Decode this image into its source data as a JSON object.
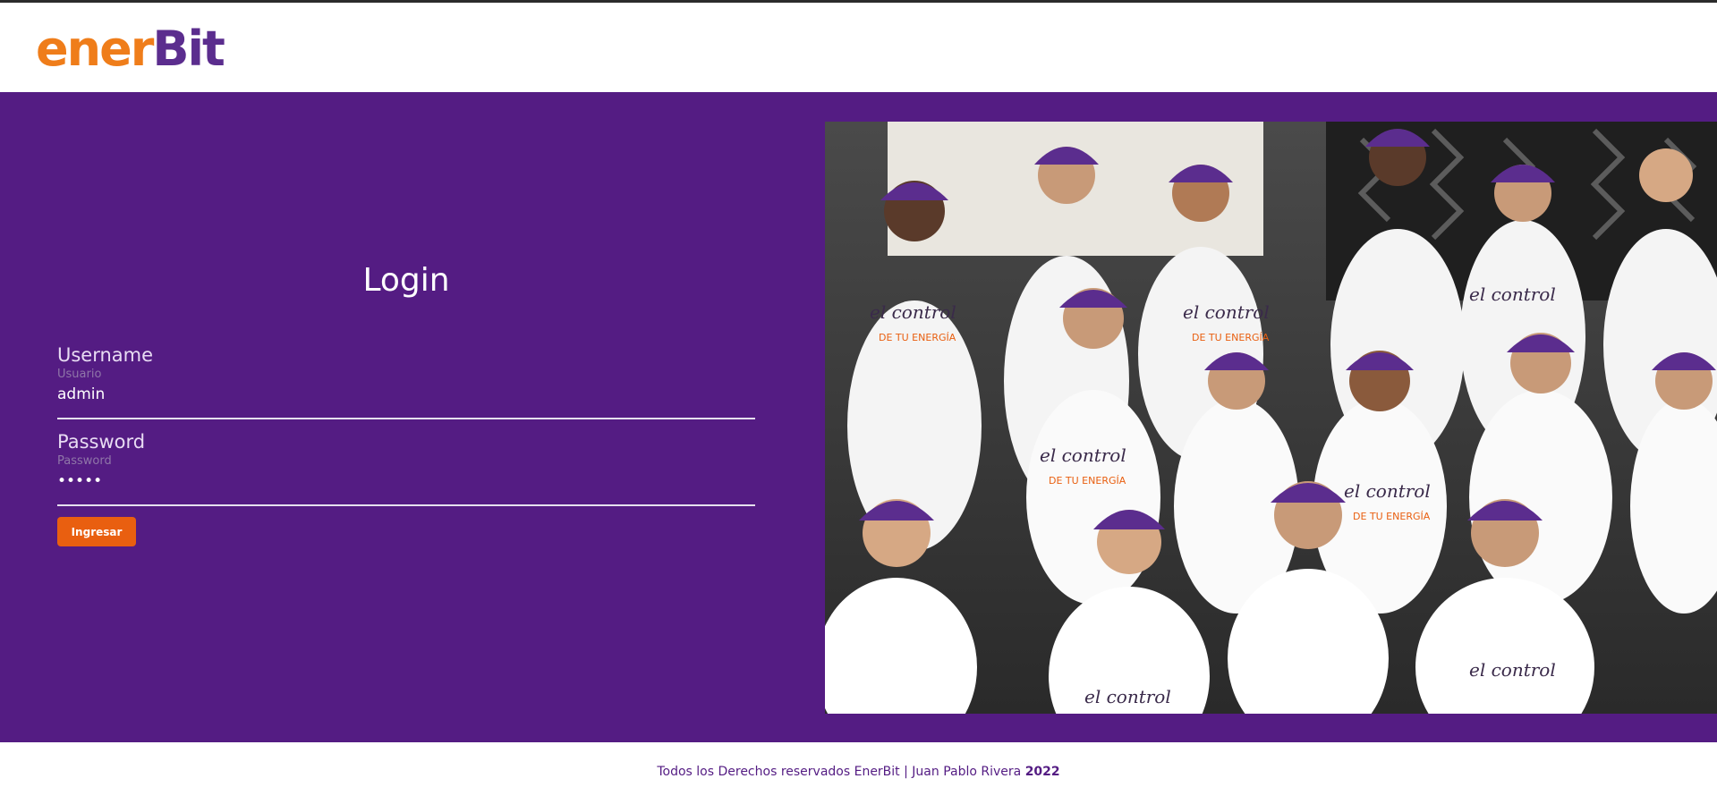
{
  "brand": {
    "logo_part1": "ener",
    "logo_part2": "Bit",
    "color_orange": "#ef7d1a",
    "color_purple": "#541c83"
  },
  "login": {
    "title": "Login",
    "username": {
      "label": "Username",
      "sublabel": "Usuario",
      "value": "admin"
    },
    "password": {
      "label": "Password",
      "sublabel": "Password",
      "value": "•••••"
    },
    "submit_label": "Ingresar"
  },
  "hero": {
    "image_alt": "Group photo of enerBit team wearing 'Toma el control de tu energía' shirts and purple caps"
  },
  "footer": {
    "text": "Todos los Derechos reservados EnerBit | Juan Pablo Rivera",
    "year": "2022"
  }
}
